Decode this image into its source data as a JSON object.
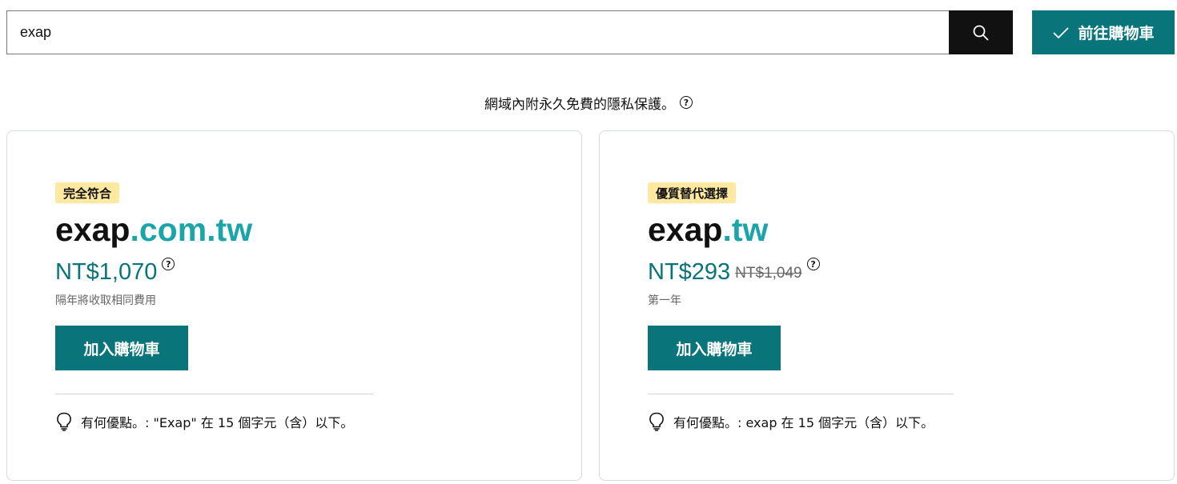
{
  "search": {
    "value": "exap",
    "search_icon": "search-icon"
  },
  "cart_button": {
    "label": "前往購物車",
    "icon": "check-icon"
  },
  "privacy_note": {
    "text": "網域內附永久免費的隱私保護。",
    "help_icon": "?"
  },
  "results": [
    {
      "badge": "完全符合",
      "sld": "exap",
      "tld": ".com.tw",
      "price": "NT$1,070",
      "old_price": "",
      "help_icon": "?",
      "subtext": "隔年將收取相同費用",
      "add_button": "加入購物車",
      "benefit_icon": "lightbulb-icon",
      "benefit": "有何優點。: \"Exap\" 在 15 個字元（含）以下。"
    },
    {
      "badge": "優質替代選擇",
      "sld": "exap",
      "tld": ".tw",
      "price": "NT$293",
      "old_price": "NT$1,049",
      "help_icon": "?",
      "subtext": "第一年",
      "add_button": "加入購物車",
      "benefit_icon": "lightbulb-icon",
      "benefit": "有何優點。: exap 在 15 個字元（含）以下。"
    }
  ],
  "colors": {
    "teal": "#09757a",
    "tld_teal": "#1ba5a8",
    "badge_yellow": "#ffe8a0",
    "search_button": "#111111"
  }
}
